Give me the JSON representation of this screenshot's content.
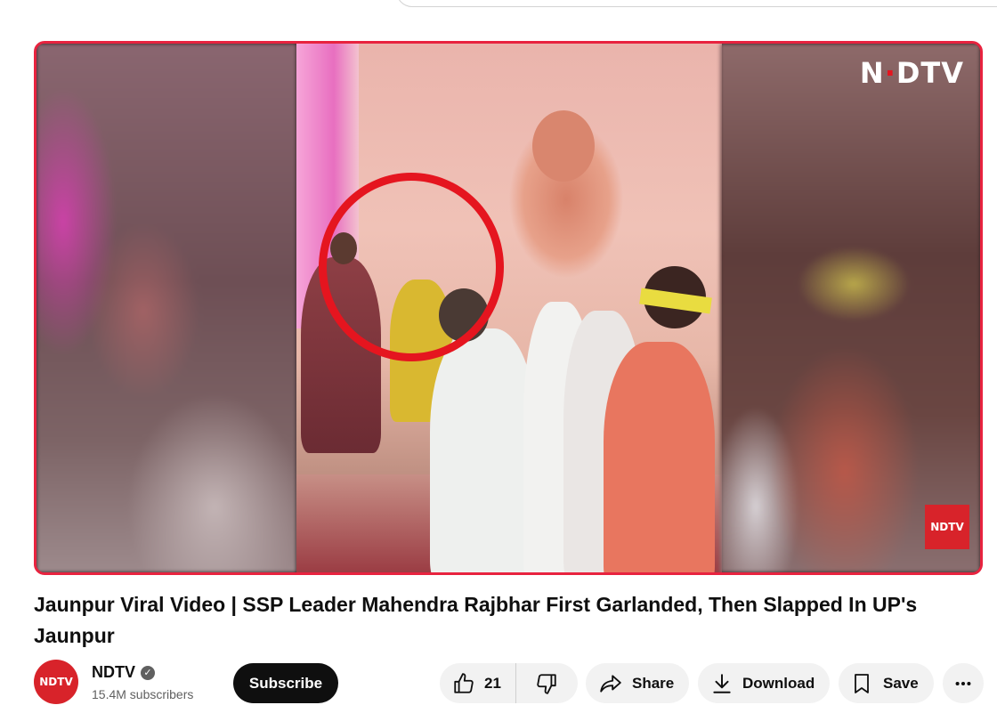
{
  "video": {
    "overlay_logo": "NDTV",
    "corner_badge": "NDTV",
    "title": "Jaunpur Viral Video | SSP Leader Mahendra Rajbhar First Garlanded, Then Slapped In UP's Jaunpur"
  },
  "channel": {
    "name": "NDTV",
    "avatar_text": "NDTV",
    "subscribers": "15.4M subscribers",
    "verified_icon": "check-circle-icon"
  },
  "actions": {
    "subscribe": "Subscribe",
    "like_count": "21",
    "share": "Share",
    "download": "Download",
    "save": "Save"
  },
  "colors": {
    "player_border": "#e8233f",
    "brand_red": "#d8232a",
    "pill_bg": "#f2f2f2"
  }
}
